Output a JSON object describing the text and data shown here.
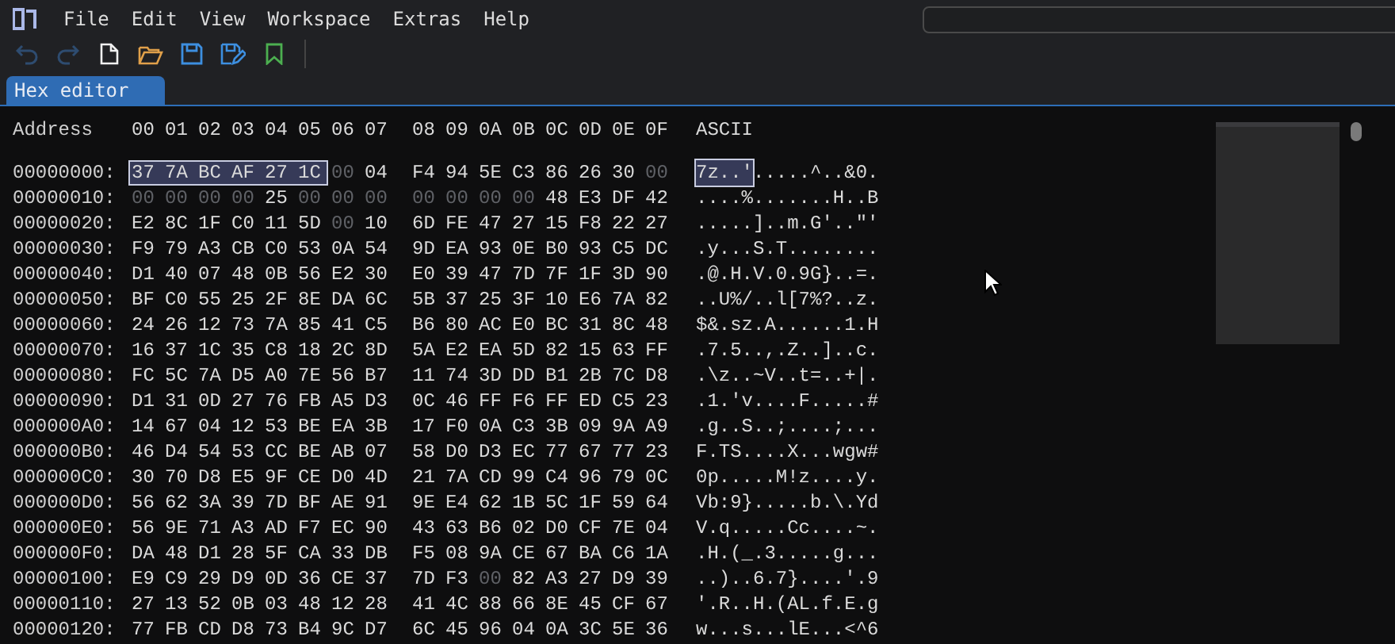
{
  "menu": [
    "File",
    "Edit",
    "View",
    "Workspace",
    "Extras",
    "Help"
  ],
  "toolbar": [
    {
      "kind": "undo",
      "disabled": true
    },
    {
      "kind": "redo",
      "disabled": true
    },
    {
      "kind": "new",
      "disabled": false
    },
    {
      "kind": "open",
      "disabled": false
    },
    {
      "kind": "save",
      "disabled": false
    },
    {
      "kind": "save-as",
      "disabled": false
    },
    {
      "kind": "bookmark",
      "disabled": false
    }
  ],
  "tabs": [
    {
      "label": "Hex editor",
      "selected": true
    }
  ],
  "header": {
    "address": "Address",
    "columns": [
      "00",
      "01",
      "02",
      "03",
      "04",
      "05",
      "06",
      "07",
      "08",
      "09",
      "0A",
      "0B",
      "0C",
      "0D",
      "0E",
      "0F"
    ],
    "ascii": "ASCII"
  },
  "rows": [
    {
      "address": "00000000:",
      "bytes": [
        {
          "hex": "37",
          "zero": false,
          "selected": true
        },
        {
          "hex": "7A",
          "zero": false,
          "selected": true
        },
        {
          "hex": "BC",
          "zero": false,
          "selected": true
        },
        {
          "hex": "AF",
          "zero": false,
          "selected": true
        },
        {
          "hex": "27",
          "zero": false,
          "selected": true
        },
        {
          "hex": "1C",
          "zero": false,
          "selected": true
        },
        {
          "hex": "00",
          "zero": true,
          "selected": false
        },
        {
          "hex": "04",
          "zero": false,
          "selected": false
        },
        {
          "hex": "F4",
          "zero": false,
          "selected": false
        },
        {
          "hex": "94",
          "zero": false,
          "selected": false
        },
        {
          "hex": "5E",
          "zero": false,
          "selected": false
        },
        {
          "hex": "C3",
          "zero": false,
          "selected": false
        },
        {
          "hex": "86",
          "zero": false,
          "selected": false
        },
        {
          "hex": "26",
          "zero": false,
          "selected": false
        },
        {
          "hex": "30",
          "zero": false,
          "selected": false
        },
        {
          "hex": "00",
          "zero": true,
          "selected": false
        }
      ],
      "ascii": [
        {
          "text": "7z..'",
          "selected": true
        },
        {
          "text": ".....^..&0.",
          "selected": false
        }
      ]
    },
    {
      "address": "00000010:",
      "bytes": [
        {
          "hex": "00",
          "zero": true,
          "selected": false
        },
        {
          "hex": "00",
          "zero": true,
          "selected": false
        },
        {
          "hex": "00",
          "zero": true,
          "selected": false
        },
        {
          "hex": "00",
          "zero": true,
          "selected": false
        },
        {
          "hex": "25",
          "zero": false,
          "selected": false
        },
        {
          "hex": "00",
          "zero": true,
          "selected": false
        },
        {
          "hex": "00",
          "zero": true,
          "selected": false
        },
        {
          "hex": "00",
          "zero": true,
          "selected": false
        },
        {
          "hex": "00",
          "zero": true,
          "selected": false
        },
        {
          "hex": "00",
          "zero": true,
          "selected": false
        },
        {
          "hex": "00",
          "zero": true,
          "selected": false
        },
        {
          "hex": "00",
          "zero": true,
          "selected": false
        },
        {
          "hex": "48",
          "zero": false,
          "selected": false
        },
        {
          "hex": "E3",
          "zero": false,
          "selected": false
        },
        {
          "hex": "DF",
          "zero": false,
          "selected": false
        },
        {
          "hex": "42",
          "zero": false,
          "selected": false
        }
      ],
      "ascii": [
        {
          "text": "....%.......H..B",
          "selected": false
        }
      ]
    },
    {
      "address": "00000020:",
      "bytes": [
        {
          "hex": "E2",
          "zero": false,
          "selected": false
        },
        {
          "hex": "8C",
          "zero": false,
          "selected": false
        },
        {
          "hex": "1F",
          "zero": false,
          "selected": false
        },
        {
          "hex": "C0",
          "zero": false,
          "selected": false
        },
        {
          "hex": "11",
          "zero": false,
          "selected": false
        },
        {
          "hex": "5D",
          "zero": false,
          "selected": false
        },
        {
          "hex": "00",
          "zero": true,
          "selected": false
        },
        {
          "hex": "10",
          "zero": false,
          "selected": false
        },
        {
          "hex": "6D",
          "zero": false,
          "selected": false
        },
        {
          "hex": "FE",
          "zero": false,
          "selected": false
        },
        {
          "hex": "47",
          "zero": false,
          "selected": false
        },
        {
          "hex": "27",
          "zero": false,
          "selected": false
        },
        {
          "hex": "15",
          "zero": false,
          "selected": false
        },
        {
          "hex": "F8",
          "zero": false,
          "selected": false
        },
        {
          "hex": "22",
          "zero": false,
          "selected": false
        },
        {
          "hex": "27",
          "zero": false,
          "selected": false
        }
      ],
      "ascii": [
        {
          "text": ".....]..m.G'..\"'",
          "selected": false
        }
      ]
    },
    {
      "address": "00000030:",
      "bytes": [
        {
          "hex": "F9",
          "zero": false,
          "selected": false
        },
        {
          "hex": "79",
          "zero": false,
          "selected": false
        },
        {
          "hex": "A3",
          "zero": false,
          "selected": false
        },
        {
          "hex": "CB",
          "zero": false,
          "selected": false
        },
        {
          "hex": "C0",
          "zero": false,
          "selected": false
        },
        {
          "hex": "53",
          "zero": false,
          "selected": false
        },
        {
          "hex": "0A",
          "zero": false,
          "selected": false
        },
        {
          "hex": "54",
          "zero": false,
          "selected": false
        },
        {
          "hex": "9D",
          "zero": false,
          "selected": false
        },
        {
          "hex": "EA",
          "zero": false,
          "selected": false
        },
        {
          "hex": "93",
          "zero": false,
          "selected": false
        },
        {
          "hex": "0E",
          "zero": false,
          "selected": false
        },
        {
          "hex": "B0",
          "zero": false,
          "selected": false
        },
        {
          "hex": "93",
          "zero": false,
          "selected": false
        },
        {
          "hex": "C5",
          "zero": false,
          "selected": false
        },
        {
          "hex": "DC",
          "zero": false,
          "selected": false
        }
      ],
      "ascii": [
        {
          "text": ".y...S.T........",
          "selected": false
        }
      ]
    },
    {
      "address": "00000040:",
      "bytes": [
        {
          "hex": "D1",
          "zero": false,
          "selected": false
        },
        {
          "hex": "40",
          "zero": false,
          "selected": false
        },
        {
          "hex": "07",
          "zero": false,
          "selected": false
        },
        {
          "hex": "48",
          "zero": false,
          "selected": false
        },
        {
          "hex": "0B",
          "zero": false,
          "selected": false
        },
        {
          "hex": "56",
          "zero": false,
          "selected": false
        },
        {
          "hex": "E2",
          "zero": false,
          "selected": false
        },
        {
          "hex": "30",
          "zero": false,
          "selected": false
        },
        {
          "hex": "E0",
          "zero": false,
          "selected": false
        },
        {
          "hex": "39",
          "zero": false,
          "selected": false
        },
        {
          "hex": "47",
          "zero": false,
          "selected": false
        },
        {
          "hex": "7D",
          "zero": false,
          "selected": false
        },
        {
          "hex": "7F",
          "zero": false,
          "selected": false
        },
        {
          "hex": "1F",
          "zero": false,
          "selected": false
        },
        {
          "hex": "3D",
          "zero": false,
          "selected": false
        },
        {
          "hex": "90",
          "zero": false,
          "selected": false
        }
      ],
      "ascii": [
        {
          "text": ".@.H.V.0.9G}..=.",
          "selected": false
        }
      ]
    },
    {
      "address": "00000050:",
      "bytes": [
        {
          "hex": "BF",
          "zero": false,
          "selected": false
        },
        {
          "hex": "C0",
          "zero": false,
          "selected": false
        },
        {
          "hex": "55",
          "zero": false,
          "selected": false
        },
        {
          "hex": "25",
          "zero": false,
          "selected": false
        },
        {
          "hex": "2F",
          "zero": false,
          "selected": false
        },
        {
          "hex": "8E",
          "zero": false,
          "selected": false
        },
        {
          "hex": "DA",
          "zero": false,
          "selected": false
        },
        {
          "hex": "6C",
          "zero": false,
          "selected": false
        },
        {
          "hex": "5B",
          "zero": false,
          "selected": false
        },
        {
          "hex": "37",
          "zero": false,
          "selected": false
        },
        {
          "hex": "25",
          "zero": false,
          "selected": false
        },
        {
          "hex": "3F",
          "zero": false,
          "selected": false
        },
        {
          "hex": "10",
          "zero": false,
          "selected": false
        },
        {
          "hex": "E6",
          "zero": false,
          "selected": false
        },
        {
          "hex": "7A",
          "zero": false,
          "selected": false
        },
        {
          "hex": "82",
          "zero": false,
          "selected": false
        }
      ],
      "ascii": [
        {
          "text": "..U%/..l[7%?..z.",
          "selected": false
        }
      ]
    },
    {
      "address": "00000060:",
      "bytes": [
        {
          "hex": "24",
          "zero": false,
          "selected": false
        },
        {
          "hex": "26",
          "zero": false,
          "selected": false
        },
        {
          "hex": "12",
          "zero": false,
          "selected": false
        },
        {
          "hex": "73",
          "zero": false,
          "selected": false
        },
        {
          "hex": "7A",
          "zero": false,
          "selected": false
        },
        {
          "hex": "85",
          "zero": false,
          "selected": false
        },
        {
          "hex": "41",
          "zero": false,
          "selected": false
        },
        {
          "hex": "C5",
          "zero": false,
          "selected": false
        },
        {
          "hex": "B6",
          "zero": false,
          "selected": false
        },
        {
          "hex": "80",
          "zero": false,
          "selected": false
        },
        {
          "hex": "AC",
          "zero": false,
          "selected": false
        },
        {
          "hex": "E0",
          "zero": false,
          "selected": false
        },
        {
          "hex": "BC",
          "zero": false,
          "selected": false
        },
        {
          "hex": "31",
          "zero": false,
          "selected": false
        },
        {
          "hex": "8C",
          "zero": false,
          "selected": false
        },
        {
          "hex": "48",
          "zero": false,
          "selected": false
        }
      ],
      "ascii": [
        {
          "text": "$&.sz.A......1.H",
          "selected": false
        }
      ]
    },
    {
      "address": "00000070:",
      "bytes": [
        {
          "hex": "16",
          "zero": false,
          "selected": false
        },
        {
          "hex": "37",
          "zero": false,
          "selected": false
        },
        {
          "hex": "1C",
          "zero": false,
          "selected": false
        },
        {
          "hex": "35",
          "zero": false,
          "selected": false
        },
        {
          "hex": "C8",
          "zero": false,
          "selected": false
        },
        {
          "hex": "18",
          "zero": false,
          "selected": false
        },
        {
          "hex": "2C",
          "zero": false,
          "selected": false
        },
        {
          "hex": "8D",
          "zero": false,
          "selected": false
        },
        {
          "hex": "5A",
          "zero": false,
          "selected": false
        },
        {
          "hex": "E2",
          "zero": false,
          "selected": false
        },
        {
          "hex": "EA",
          "zero": false,
          "selected": false
        },
        {
          "hex": "5D",
          "zero": false,
          "selected": false
        },
        {
          "hex": "82",
          "zero": false,
          "selected": false
        },
        {
          "hex": "15",
          "zero": false,
          "selected": false
        },
        {
          "hex": "63",
          "zero": false,
          "selected": false
        },
        {
          "hex": "FF",
          "zero": false,
          "selected": false
        }
      ],
      "ascii": [
        {
          "text": ".7.5..,.Z..]..c.",
          "selected": false
        }
      ]
    },
    {
      "address": "00000080:",
      "bytes": [
        {
          "hex": "FC",
          "zero": false,
          "selected": false
        },
        {
          "hex": "5C",
          "zero": false,
          "selected": false
        },
        {
          "hex": "7A",
          "zero": false,
          "selected": false
        },
        {
          "hex": "D5",
          "zero": false,
          "selected": false
        },
        {
          "hex": "A0",
          "zero": false,
          "selected": false
        },
        {
          "hex": "7E",
          "zero": false,
          "selected": false
        },
        {
          "hex": "56",
          "zero": false,
          "selected": false
        },
        {
          "hex": "B7",
          "zero": false,
          "selected": false
        },
        {
          "hex": "11",
          "zero": false,
          "selected": false
        },
        {
          "hex": "74",
          "zero": false,
          "selected": false
        },
        {
          "hex": "3D",
          "zero": false,
          "selected": false
        },
        {
          "hex": "DD",
          "zero": false,
          "selected": false
        },
        {
          "hex": "B1",
          "zero": false,
          "selected": false
        },
        {
          "hex": "2B",
          "zero": false,
          "selected": false
        },
        {
          "hex": "7C",
          "zero": false,
          "selected": false
        },
        {
          "hex": "D8",
          "zero": false,
          "selected": false
        }
      ],
      "ascii": [
        {
          "text": ".\\z..~V..t=..+|.",
          "selected": false
        }
      ]
    },
    {
      "address": "00000090:",
      "bytes": [
        {
          "hex": "D1",
          "zero": false,
          "selected": false
        },
        {
          "hex": "31",
          "zero": false,
          "selected": false
        },
        {
          "hex": "0D",
          "zero": false,
          "selected": false
        },
        {
          "hex": "27",
          "zero": false,
          "selected": false
        },
        {
          "hex": "76",
          "zero": false,
          "selected": false
        },
        {
          "hex": "FB",
          "zero": false,
          "selected": false
        },
        {
          "hex": "A5",
          "zero": false,
          "selected": false
        },
        {
          "hex": "D3",
          "zero": false,
          "selected": false
        },
        {
          "hex": "0C",
          "zero": false,
          "selected": false
        },
        {
          "hex": "46",
          "zero": false,
          "selected": false
        },
        {
          "hex": "FF",
          "zero": false,
          "selected": false
        },
        {
          "hex": "F6",
          "zero": false,
          "selected": false
        },
        {
          "hex": "FF",
          "zero": false,
          "selected": false
        },
        {
          "hex": "ED",
          "zero": false,
          "selected": false
        },
        {
          "hex": "C5",
          "zero": false,
          "selected": false
        },
        {
          "hex": "23",
          "zero": false,
          "selected": false
        }
      ],
      "ascii": [
        {
          "text": ".1.'v....F.....#",
          "selected": false
        }
      ]
    },
    {
      "address": "000000A0:",
      "bytes": [
        {
          "hex": "14",
          "zero": false,
          "selected": false
        },
        {
          "hex": "67",
          "zero": false,
          "selected": false
        },
        {
          "hex": "04",
          "zero": false,
          "selected": false
        },
        {
          "hex": "12",
          "zero": false,
          "selected": false
        },
        {
          "hex": "53",
          "zero": false,
          "selected": false
        },
        {
          "hex": "BE",
          "zero": false,
          "selected": false
        },
        {
          "hex": "EA",
          "zero": false,
          "selected": false
        },
        {
          "hex": "3B",
          "zero": false,
          "selected": false
        },
        {
          "hex": "17",
          "zero": false,
          "selected": false
        },
        {
          "hex": "F0",
          "zero": false,
          "selected": false
        },
        {
          "hex": "0A",
          "zero": false,
          "selected": false
        },
        {
          "hex": "C3",
          "zero": false,
          "selected": false
        },
        {
          "hex": "3B",
          "zero": false,
          "selected": false
        },
        {
          "hex": "09",
          "zero": false,
          "selected": false
        },
        {
          "hex": "9A",
          "zero": false,
          "selected": false
        },
        {
          "hex": "A9",
          "zero": false,
          "selected": false
        }
      ],
      "ascii": [
        {
          "text": ".g..S..;....;...",
          "selected": false
        }
      ]
    },
    {
      "address": "000000B0:",
      "bytes": [
        {
          "hex": "46",
          "zero": false,
          "selected": false
        },
        {
          "hex": "D4",
          "zero": false,
          "selected": false
        },
        {
          "hex": "54",
          "zero": false,
          "selected": false
        },
        {
          "hex": "53",
          "zero": false,
          "selected": false
        },
        {
          "hex": "CC",
          "zero": false,
          "selected": false
        },
        {
          "hex": "BE",
          "zero": false,
          "selected": false
        },
        {
          "hex": "AB",
          "zero": false,
          "selected": false
        },
        {
          "hex": "07",
          "zero": false,
          "selected": false
        },
        {
          "hex": "58",
          "zero": false,
          "selected": false
        },
        {
          "hex": "D0",
          "zero": false,
          "selected": false
        },
        {
          "hex": "D3",
          "zero": false,
          "selected": false
        },
        {
          "hex": "EC",
          "zero": false,
          "selected": false
        },
        {
          "hex": "77",
          "zero": false,
          "selected": false
        },
        {
          "hex": "67",
          "zero": false,
          "selected": false
        },
        {
          "hex": "77",
          "zero": false,
          "selected": false
        },
        {
          "hex": "23",
          "zero": false,
          "selected": false
        }
      ],
      "ascii": [
        {
          "text": "F.TS....X...wgw#",
          "selected": false
        }
      ]
    },
    {
      "address": "000000C0:",
      "bytes": [
        {
          "hex": "30",
          "zero": false,
          "selected": false
        },
        {
          "hex": "70",
          "zero": false,
          "selected": false
        },
        {
          "hex": "D8",
          "zero": false,
          "selected": false
        },
        {
          "hex": "E5",
          "zero": false,
          "selected": false
        },
        {
          "hex": "9F",
          "zero": false,
          "selected": false
        },
        {
          "hex": "CE",
          "zero": false,
          "selected": false
        },
        {
          "hex": "D0",
          "zero": false,
          "selected": false
        },
        {
          "hex": "4D",
          "zero": false,
          "selected": false
        },
        {
          "hex": "21",
          "zero": false,
          "selected": false
        },
        {
          "hex": "7A",
          "zero": false,
          "selected": false
        },
        {
          "hex": "CD",
          "zero": false,
          "selected": false
        },
        {
          "hex": "99",
          "zero": false,
          "selected": false
        },
        {
          "hex": "C4",
          "zero": false,
          "selected": false
        },
        {
          "hex": "96",
          "zero": false,
          "selected": false
        },
        {
          "hex": "79",
          "zero": false,
          "selected": false
        },
        {
          "hex": "0C",
          "zero": false,
          "selected": false
        }
      ],
      "ascii": [
        {
          "text": "0p.....M!z....y.",
          "selected": false
        }
      ]
    },
    {
      "address": "000000D0:",
      "bytes": [
        {
          "hex": "56",
          "zero": false,
          "selected": false
        },
        {
          "hex": "62",
          "zero": false,
          "selected": false
        },
        {
          "hex": "3A",
          "zero": false,
          "selected": false
        },
        {
          "hex": "39",
          "zero": false,
          "selected": false
        },
        {
          "hex": "7D",
          "zero": false,
          "selected": false
        },
        {
          "hex": "BF",
          "zero": false,
          "selected": false
        },
        {
          "hex": "AE",
          "zero": false,
          "selected": false
        },
        {
          "hex": "91",
          "zero": false,
          "selected": false
        },
        {
          "hex": "9E",
          "zero": false,
          "selected": false
        },
        {
          "hex": "E4",
          "zero": false,
          "selected": false
        },
        {
          "hex": "62",
          "zero": false,
          "selected": false
        },
        {
          "hex": "1B",
          "zero": false,
          "selected": false
        },
        {
          "hex": "5C",
          "zero": false,
          "selected": false
        },
        {
          "hex": "1F",
          "zero": false,
          "selected": false
        },
        {
          "hex": "59",
          "zero": false,
          "selected": false
        },
        {
          "hex": "64",
          "zero": false,
          "selected": false
        }
      ],
      "ascii": [
        {
          "text": "Vb:9}.....b.\\.Yd",
          "selected": false
        }
      ]
    },
    {
      "address": "000000E0:",
      "bytes": [
        {
          "hex": "56",
          "zero": false,
          "selected": false
        },
        {
          "hex": "9E",
          "zero": false,
          "selected": false
        },
        {
          "hex": "71",
          "zero": false,
          "selected": false
        },
        {
          "hex": "A3",
          "zero": false,
          "selected": false
        },
        {
          "hex": "AD",
          "zero": false,
          "selected": false
        },
        {
          "hex": "F7",
          "zero": false,
          "selected": false
        },
        {
          "hex": "EC",
          "zero": false,
          "selected": false
        },
        {
          "hex": "90",
          "zero": false,
          "selected": false
        },
        {
          "hex": "43",
          "zero": false,
          "selected": false
        },
        {
          "hex": "63",
          "zero": false,
          "selected": false
        },
        {
          "hex": "B6",
          "zero": false,
          "selected": false
        },
        {
          "hex": "02",
          "zero": false,
          "selected": false
        },
        {
          "hex": "D0",
          "zero": false,
          "selected": false
        },
        {
          "hex": "CF",
          "zero": false,
          "selected": false
        },
        {
          "hex": "7E",
          "zero": false,
          "selected": false
        },
        {
          "hex": "04",
          "zero": false,
          "selected": false
        }
      ],
      "ascii": [
        {
          "text": "V.q.....Cc....~.",
          "selected": false
        }
      ]
    },
    {
      "address": "000000F0:",
      "bytes": [
        {
          "hex": "DA",
          "zero": false,
          "selected": false
        },
        {
          "hex": "48",
          "zero": false,
          "selected": false
        },
        {
          "hex": "D1",
          "zero": false,
          "selected": false
        },
        {
          "hex": "28",
          "zero": false,
          "selected": false
        },
        {
          "hex": "5F",
          "zero": false,
          "selected": false
        },
        {
          "hex": "CA",
          "zero": false,
          "selected": false
        },
        {
          "hex": "33",
          "zero": false,
          "selected": false
        },
        {
          "hex": "DB",
          "zero": false,
          "selected": false
        },
        {
          "hex": "F5",
          "zero": false,
          "selected": false
        },
        {
          "hex": "08",
          "zero": false,
          "selected": false
        },
        {
          "hex": "9A",
          "zero": false,
          "selected": false
        },
        {
          "hex": "CE",
          "zero": false,
          "selected": false
        },
        {
          "hex": "67",
          "zero": false,
          "selected": false
        },
        {
          "hex": "BA",
          "zero": false,
          "selected": false
        },
        {
          "hex": "C6",
          "zero": false,
          "selected": false
        },
        {
          "hex": "1A",
          "zero": false,
          "selected": false
        }
      ],
      "ascii": [
        {
          "text": ".H.(_.3.....g...",
          "selected": false
        }
      ]
    },
    {
      "address": "00000100:",
      "bytes": [
        {
          "hex": "E9",
          "zero": false,
          "selected": false
        },
        {
          "hex": "C9",
          "zero": false,
          "selected": false
        },
        {
          "hex": "29",
          "zero": false,
          "selected": false
        },
        {
          "hex": "D9",
          "zero": false,
          "selected": false
        },
        {
          "hex": "0D",
          "zero": false,
          "selected": false
        },
        {
          "hex": "36",
          "zero": false,
          "selected": false
        },
        {
          "hex": "CE",
          "zero": false,
          "selected": false
        },
        {
          "hex": "37",
          "zero": false,
          "selected": false
        },
        {
          "hex": "7D",
          "zero": false,
          "selected": false
        },
        {
          "hex": "F3",
          "zero": false,
          "selected": false
        },
        {
          "hex": "00",
          "zero": true,
          "selected": false
        },
        {
          "hex": "82",
          "zero": false,
          "selected": false
        },
        {
          "hex": "A3",
          "zero": false,
          "selected": false
        },
        {
          "hex": "27",
          "zero": false,
          "selected": false
        },
        {
          "hex": "D9",
          "zero": false,
          "selected": false
        },
        {
          "hex": "39",
          "zero": false,
          "selected": false
        }
      ],
      "ascii": [
        {
          "text": "..)..6.7}....'.9",
          "selected": false
        }
      ]
    },
    {
      "address": "00000110:",
      "bytes": [
        {
          "hex": "27",
          "zero": false,
          "selected": false
        },
        {
          "hex": "13",
          "zero": false,
          "selected": false
        },
        {
          "hex": "52",
          "zero": false,
          "selected": false
        },
        {
          "hex": "0B",
          "zero": false,
          "selected": false
        },
        {
          "hex": "03",
          "zero": false,
          "selected": false
        },
        {
          "hex": "48",
          "zero": false,
          "selected": false
        },
        {
          "hex": "12",
          "zero": false,
          "selected": false
        },
        {
          "hex": "28",
          "zero": false,
          "selected": false
        },
        {
          "hex": "41",
          "zero": false,
          "selected": false
        },
        {
          "hex": "4C",
          "zero": false,
          "selected": false
        },
        {
          "hex": "88",
          "zero": false,
          "selected": false
        },
        {
          "hex": "66",
          "zero": false,
          "selected": false
        },
        {
          "hex": "8E",
          "zero": false,
          "selected": false
        },
        {
          "hex": "45",
          "zero": false,
          "selected": false
        },
        {
          "hex": "CF",
          "zero": false,
          "selected": false
        },
        {
          "hex": "67",
          "zero": false,
          "selected": false
        }
      ],
      "ascii": [
        {
          "text": "'.R..H.(AL.f.E.g",
          "selected": false
        }
      ]
    },
    {
      "address": "00000120:",
      "bytes": [
        {
          "hex": "77",
          "zero": false,
          "selected": false
        },
        {
          "hex": "FB",
          "zero": false,
          "selected": false
        },
        {
          "hex": "CD",
          "zero": false,
          "selected": false
        },
        {
          "hex": "D8",
          "zero": false,
          "selected": false
        },
        {
          "hex": "73",
          "zero": false,
          "selected": false
        },
        {
          "hex": "B4",
          "zero": false,
          "selected": false
        },
        {
          "hex": "9C",
          "zero": false,
          "selected": false
        },
        {
          "hex": "D7",
          "zero": false,
          "selected": false
        },
        {
          "hex": "6C",
          "zero": false,
          "selected": false
        },
        {
          "hex": "45",
          "zero": false,
          "selected": false
        },
        {
          "hex": "96",
          "zero": false,
          "selected": false
        },
        {
          "hex": "04",
          "zero": false,
          "selected": false
        },
        {
          "hex": "0A",
          "zero": false,
          "selected": false
        },
        {
          "hex": "3C",
          "zero": false,
          "selected": false
        },
        {
          "hex": "5E",
          "zero": false,
          "selected": false
        },
        {
          "hex": "36",
          "zero": false,
          "selected": false
        }
      ],
      "ascii": [
        {
          "text": "w...s...lE...<^6",
          "selected": false
        }
      ]
    }
  ]
}
